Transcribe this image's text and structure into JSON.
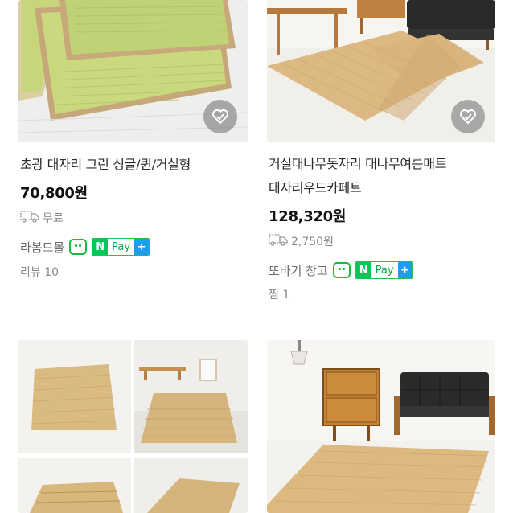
{
  "products": [
    {
      "title_lines": [
        "초광 대자리 그린 싱글/퀸/거실형"
      ],
      "price": "70,800원",
      "shipping": "무료",
      "store": "라봄므몰",
      "pay_label": "Pay",
      "pay_n": "N",
      "meta": "리뷰 10"
    },
    {
      "title_lines": [
        "거실대나무돗자리 대나무여름매트",
        "대자리우드카페트"
      ],
      "price": "128,320원",
      "shipping": "2,750원",
      "store": "또바기 창고",
      "pay_label": "Pay",
      "pay_n": "N",
      "meta": "찜 1"
    }
  ],
  "icons": {
    "wishlist": "heart-icon",
    "shipping": "truck-icon",
    "talk": "talktalk-icon",
    "pay_plus": "plus-icon"
  },
  "colors": {
    "naver_green": "#03c75a",
    "pay_plus_blue": "#1e9cf0"
  }
}
